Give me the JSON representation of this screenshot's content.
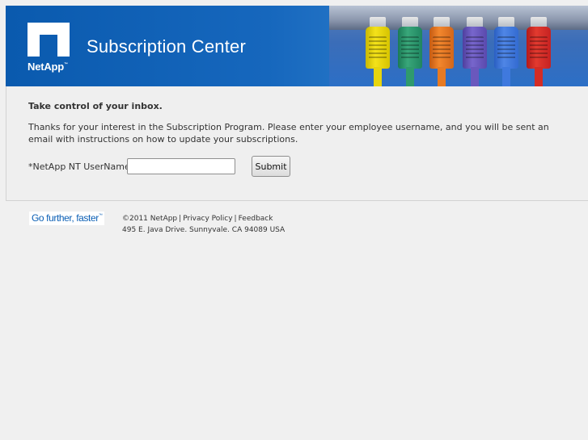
{
  "header": {
    "brand": "NetApp",
    "title": "Subscription Center"
  },
  "main": {
    "heading": "Take control of your inbox.",
    "intro": "Thanks for your interest in the Subscription Program. Please enter your employee username, and you will be sent an email with instructions on how to update your subscriptions.",
    "form": {
      "username_label": "*NetApp NT UserName:",
      "username_value": "",
      "submit_label": "Submit"
    }
  },
  "footer": {
    "tagline": "Go further, faster",
    "copyright": "©2011 NetApp",
    "links": [
      "Privacy Policy",
      "Feedback"
    ],
    "address": "495 E. Java Drive. Sunnyvale. CA 94089 USA"
  },
  "colors": {
    "banner_blue": "#1667bd",
    "page_bg": "#f0f0f0",
    "tagline_blue": "#0b5fb5"
  },
  "icons": [
    "netapp-logo",
    "ethernet-cables-image"
  ]
}
